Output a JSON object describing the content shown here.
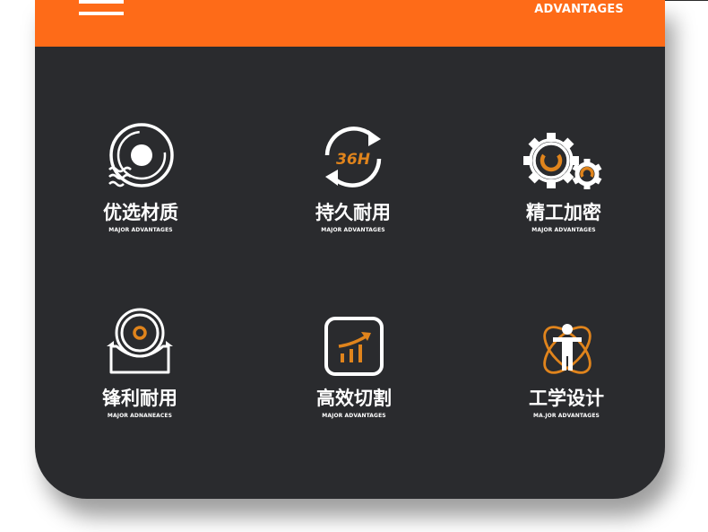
{
  "colors": {
    "accent": "#fe6b18",
    "icon_accent": "#e0841c",
    "card_background": "#2a2b2e",
    "text": "#ffffff"
  },
  "banner": {
    "caption": "ADVANTAGES",
    "menu_icon": "hamburger-menu-icon"
  },
  "features": [
    {
      "icon": "material-disc-icon",
      "title": "优选材质",
      "subtitle": "MAJOR ADVANTAGES"
    },
    {
      "icon": "durability-36h-icon",
      "title": "持久耐用",
      "subtitle": "MAJOR ADVANTAGES"
    },
    {
      "icon": "precision-gears-icon",
      "title": "精工加密",
      "subtitle": "MAJOR ADVANTAGES"
    },
    {
      "icon": "sharp-blade-icon",
      "title": "锋利耐用",
      "subtitle": "MAJOR ADNANEACES"
    },
    {
      "icon": "efficiency-chart-icon",
      "title": "高效切割",
      "subtitle": "MAJOR ADVANTAGES"
    },
    {
      "icon": "ergonomic-figure-icon",
      "title": "工学设计",
      "subtitle": "MA.JOR ADVANTAGES"
    }
  ]
}
